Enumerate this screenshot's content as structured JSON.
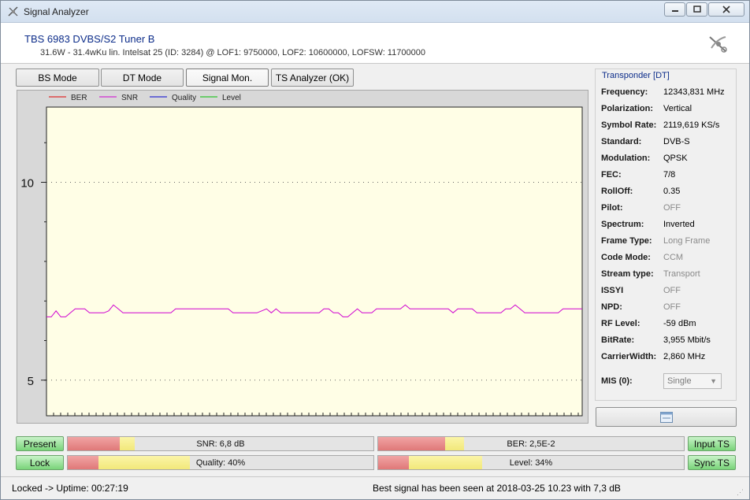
{
  "window": {
    "title": "Signal Analyzer",
    "icon": "satellite-icon",
    "controls": [
      "minimize-icon",
      "maximize-icon",
      "close-icon"
    ]
  },
  "header": {
    "device": "TBS 6983 DVBS/S2 Tuner B",
    "satellite_info": "31.6W - 31.4wKu lin. Intelsat 25 (ID: 3284) @ LOF1: 9750000, LOF2: 10600000, LOFSW: 11700000",
    "logo": "satellite-dish-icon"
  },
  "tabs": [
    {
      "label": "BS Mode"
    },
    {
      "label": "DT Mode"
    },
    {
      "label": "Signal Mon.",
      "active": true
    },
    {
      "label": "TS Analyzer (OK)"
    }
  ],
  "chart_data": {
    "type": "line",
    "legend": [
      {
        "name": "BER",
        "color": "#e00000"
      },
      {
        "name": "SNR",
        "color": "#d000d0"
      },
      {
        "name": "Quality",
        "color": "#0000d0"
      },
      {
        "name": "Level",
        "color": "#00c000"
      }
    ],
    "y_ticks": [
      "10",
      "5"
    ],
    "ylim": [
      4.1,
      11.9
    ],
    "grid": true,
    "series": [
      {
        "name": "SNR",
        "values": [
          6.6,
          6.6,
          6.75,
          6.6,
          6.6,
          6.7,
          6.8,
          6.8,
          6.8,
          6.7,
          6.7,
          6.7,
          6.7,
          6.75,
          6.9,
          6.8,
          6.7,
          6.7,
          6.7,
          6.7,
          6.7,
          6.7,
          6.7,
          6.7,
          6.7,
          6.7,
          6.7,
          6.8,
          6.8,
          6.8,
          6.8,
          6.8,
          6.8,
          6.8,
          6.8,
          6.8,
          6.8,
          6.8,
          6.8,
          6.7,
          6.7,
          6.7,
          6.7,
          6.7,
          6.7,
          6.75,
          6.8,
          6.7,
          6.8,
          6.7,
          6.7,
          6.7,
          6.7,
          6.7,
          6.7,
          6.7,
          6.7,
          6.7,
          6.8,
          6.8,
          6.7,
          6.7,
          6.6,
          6.6,
          6.7,
          6.8,
          6.7,
          6.7,
          6.7,
          6.8,
          6.8,
          6.8,
          6.8,
          6.8,
          6.8,
          6.9,
          6.8,
          6.8,
          6.8,
          6.8,
          6.8,
          6.8,
          6.8,
          6.8,
          6.8,
          6.7,
          6.8,
          6.8,
          6.8,
          6.8,
          6.7,
          6.7,
          6.7,
          6.7,
          6.7,
          6.7,
          6.8,
          6.8,
          6.9,
          6.8,
          6.7,
          6.7,
          6.7,
          6.7,
          6.7,
          6.7,
          6.7,
          6.7,
          6.8,
          6.8,
          6.8,
          6.8,
          6.8
        ]
      }
    ]
  },
  "transponder": {
    "title": "Transponder [DT]",
    "properties": [
      {
        "label": "Frequency:",
        "value": "12343,831 MHz"
      },
      {
        "label": "Polarization:",
        "value": "Vertical"
      },
      {
        "label": "Symbol Rate:",
        "value": "2119,619 KS/s"
      },
      {
        "label": "Standard:",
        "value": "DVB-S"
      },
      {
        "label": "Modulation:",
        "value": "QPSK"
      },
      {
        "label": "FEC:",
        "value": "7/8"
      },
      {
        "label": "RollOff:",
        "value": "0.35"
      },
      {
        "label": "Pilot:",
        "value": "OFF",
        "dim": true
      },
      {
        "label": "Spectrum:",
        "value": "Inverted"
      },
      {
        "label": "Frame Type:",
        "value": "Long Frame",
        "dim": true
      },
      {
        "label": "Code Mode:",
        "value": "CCM",
        "dim": true
      },
      {
        "label": "Stream type:",
        "value": "Transport",
        "dim": true
      },
      {
        "label": "ISSYI",
        "value": "OFF",
        "dim": true
      },
      {
        "label": "NPD:",
        "value": "OFF",
        "dim": true
      },
      {
        "label": "RF Level:",
        "value": "-59 dBm"
      },
      {
        "label": "BitRate:",
        "value": "3,955 Mbit/s"
      },
      {
        "label": "CarrierWidth:",
        "value": "2,860 MHz"
      }
    ],
    "mis_label": "MIS (0):",
    "mis_value": "Single"
  },
  "snapshot_icon": "window-icon",
  "status_buttons": {
    "present": "Present",
    "lock": "Lock",
    "input_ts": "Input TS",
    "sync_ts": "Sync TS"
  },
  "meters": {
    "snr": {
      "label": "SNR: 6,8 dB",
      "red": 0.17,
      "yellow": 0.05
    },
    "ber": {
      "label": "BER: 2,5E-2",
      "red": 0.22,
      "yellow": 0.06
    },
    "quality": {
      "label": "Quality: 40%",
      "red": 0.1,
      "yellow": 0.3
    },
    "level": {
      "label": "Level: 34%",
      "red": 0.1,
      "yellow": 0.24
    }
  },
  "statusbar": {
    "uptime": "Locked -> Uptime: 00:27:19",
    "message": "Best signal has been seen at 2018-03-25 10.23 with 7,3 dB"
  }
}
